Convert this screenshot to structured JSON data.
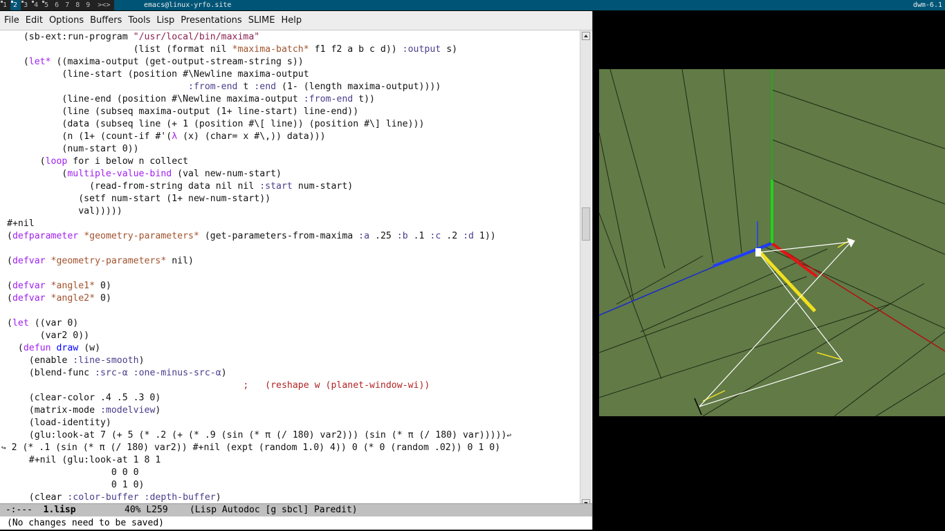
{
  "wm": {
    "tags": [
      "1",
      "2",
      "3",
      "4",
      "5",
      "6",
      "7",
      "8",
      "9"
    ],
    "selected_tag": "2",
    "layout_symbol": "><>",
    "window_title": "emacs@linux-yrfo.site",
    "status": "dwm-6.1"
  },
  "menu": [
    "File",
    "Edit",
    "Options",
    "Buffers",
    "Tools",
    "Lisp",
    "Presentations",
    "SLIME",
    "Help"
  ],
  "code_lines": [
    "   (sb-ext:run-program \"/usr/local/bin/maxima\"",
    "                       (list (format nil *maxima-batch* f1 f2 a b c d)) :output s)",
    "   (let* ((maxima-output (get-output-stream-string s))",
    "          (line-start (position #\\Newline maxima-output",
    "                                 :from-end t :end (1- (length maxima-output))))",
    "          (line-end (position #\\Newline maxima-output :from-end t))",
    "          (line (subseq maxima-output (1+ line-start) line-end))",
    "          (data (subseq line (+ 1 (position #\\[ line)) (position #\\] line)))",
    "          (n (1+ (count-if #'(λ (x) (char= x #\\,)) data)))",
    "          (num-start 0))",
    "      (loop for i below n collect",
    "          (multiple-value-bind (val new-num-start)",
    "               (read-from-string data nil nil :start num-start)",
    "             (setf num-start (1+ new-num-start))",
    "             val)))))",
    "#+nil",
    "(defparameter *geometry-parameters* (get-parameters-from-maxima :a .25 :b .1 :c .2 :d 1))",
    "",
    "(defvar *geometry-parameters* nil)",
    "",
    "(defvar *angle1* 0)",
    "(defvar *angle2* 0)",
    "",
    "(let ((var 0)",
    "      (var2 0))",
    "  (defun draw (w)",
    "    (enable :line-smooth)",
    "    (blend-func :src-α :one-minus-src-α)",
    "                                           ;   (reshape w (planet-window-wi))",
    "    (clear-color .4 .5 .3 0)",
    "    (matrix-mode :modelview)",
    "    (load-identity)",
    "    (glu:look-at 7 (+ 5 (* .2 (+ (* .9 (sin (* π (/ 180) var2))) (sin (* π (/ 180) var)))))",
    " 2 (* .1 (sin (* π (/ 180) var2)) #+nil (expt (random 1.0) 4)) 0 (* 0 (random .02)) 0 1 0)",
    "    #+nil (glu:look-at 1 8 1",
    "                   0 0 0",
    "                   0 1 0)",
    "    (clear :color-buffer :depth-buffer)"
  ],
  "modeline": {
    "status": " -:---  ",
    "buffer_name": "1.lisp",
    "position": "         40% L259    ",
    "modes": "(Lisp Autodoc [g sbcl] Paredit)"
  },
  "minibuffer": "(No changes need to be saved)",
  "colors": {
    "gl_background": "#617a46",
    "keyword": "#a020f0",
    "string": "#8b2252",
    "variable": "#a0522d",
    "function": "#0000ff",
    "constant": "#483d8b",
    "comment": "#b22222"
  }
}
